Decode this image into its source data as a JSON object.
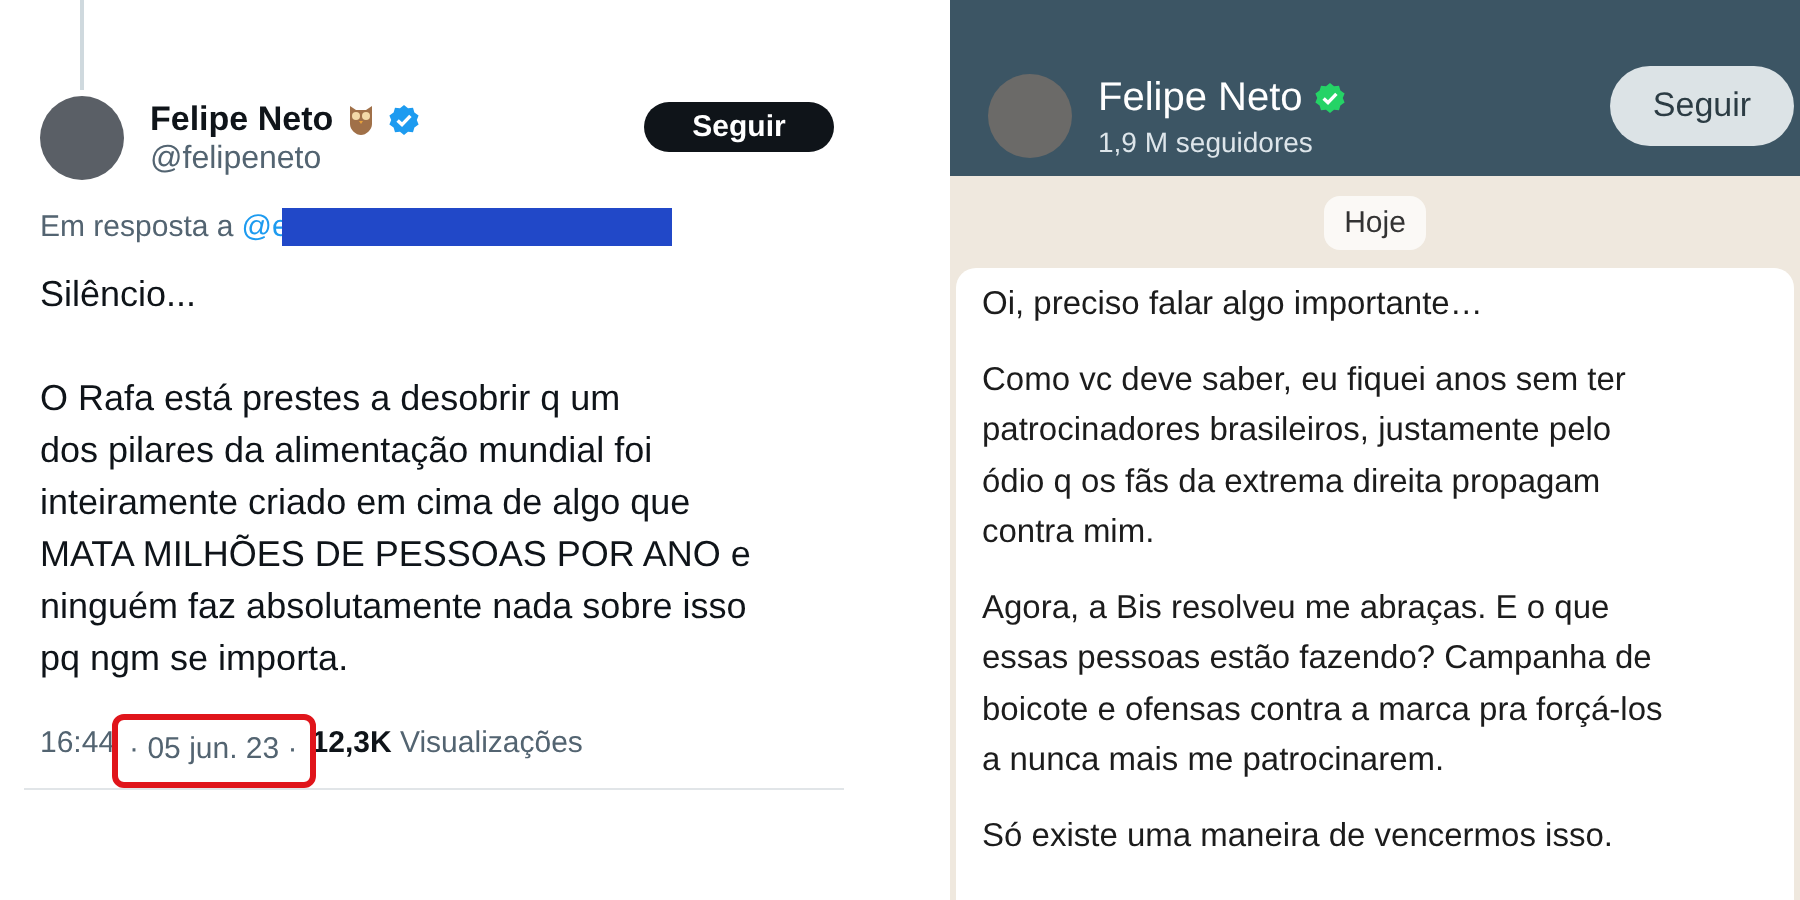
{
  "tweet": {
    "author": {
      "name": "Felipe Neto",
      "handle": "@felipeneto",
      "verified": true
    },
    "follow_button": "Seguir",
    "reply_to": {
      "label": "Em resposta a",
      "mention": "@e",
      "redacted": true
    },
    "paragraphs": [
      "Silêncio...",
      "O Rafa está prestes a desobrir q um\ndos pilares da alimentação mundial foi\ninteiramente criado em cima de algo que\nMATA MILHÕES DE PESSOAS POR ANO e\nninguém faz absolutamente nada sobre isso\npq ngm se importa."
    ],
    "time": "16:44",
    "separator": "·",
    "date": "05 jun. 23",
    "date_highlighted": true,
    "views_count": "12,3K",
    "views_label": "Visualizações"
  },
  "channel": {
    "name": "Felipe Neto",
    "verified": true,
    "followers": "1,9 M seguidores",
    "follow_button": "Seguir",
    "date_chip": "Hoje",
    "message": [
      "Oi, preciso falar algo importante…",
      "Como vc deve saber, eu fiquei anos sem ter\npatrocinadores brasileiros, justamente pelo\nódio q os fãs da extrema direita propagam\ncontra mim.",
      "Agora, a Bis resolveu me abraças. E o que\nessas pessoas estão fazendo? Campanha de\nboicote e ofensas contra a marca pra forçá-los\na nunca mais me patrocinarem.",
      "Só existe uma maneira de vencermos isso."
    ]
  }
}
